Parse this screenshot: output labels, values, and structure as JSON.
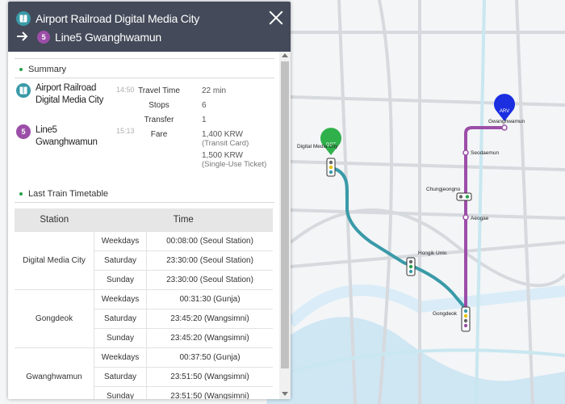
{
  "header": {
    "origin": "Airport Railroad Digital Media City",
    "origin_badge": "AREX",
    "destination": "Line5 Gwanghwamun",
    "destination_badge": "5"
  },
  "summary": {
    "title": "Summary",
    "from_station": [
      "Airport Railroad",
      "Digital Media City"
    ],
    "from_time": "14:50",
    "to_station": [
      "Line5",
      "Gwanghwamun"
    ],
    "to_time": "15:13",
    "labels": {
      "travel_time": "Travel Time",
      "stops": "Stops",
      "transfer": "Transfer",
      "fare": "Fare"
    },
    "values": {
      "travel_time": "22 min",
      "stops": "6",
      "transfer": "1",
      "fare_transit": "1,400 KRW",
      "fare_transit_note": "(Transit Card)",
      "fare_single": "1,500 KRW",
      "fare_single_note": "(Single-Use Ticket)"
    }
  },
  "timetable": {
    "title": "Last Train Timetable",
    "columns": [
      "Station",
      "Time"
    ],
    "rows": [
      {
        "station": "Digital Media City",
        "entries": [
          {
            "day": "Weekdays",
            "time": "00:08:00 (Seoul Station)"
          },
          {
            "day": "Saturday",
            "time": "23:30:00 (Seoul Station)"
          },
          {
            "day": "Sunday",
            "time": "23:30:00 (Seoul Station)"
          }
        ]
      },
      {
        "station": "Gongdeok",
        "entries": [
          {
            "day": "Weekdays",
            "time": "00:31:30 (Gunja)"
          },
          {
            "day": "Saturday",
            "time": "23:45:20 (Wangsimni)"
          },
          {
            "day": "Sunday",
            "time": "23:45:20 (Wangsimni)"
          }
        ]
      },
      {
        "station": "Gwanghwamun",
        "entries": [
          {
            "day": "Weekdays",
            "time": "00:37:50 (Gunja)"
          },
          {
            "day": "Saturday",
            "time": "23:51:50 (Wangsimni)"
          },
          {
            "day": "Sunday",
            "time": "23:51:50 (Wangsimni)"
          }
        ]
      }
    ]
  },
  "map": {
    "dpt_marker": "DPT",
    "arv_marker": "ARV",
    "labels": {
      "dmc": "Digital Media City",
      "gwanghwamun": "Gwanghwamun",
      "seodaemun": "Seodaemun",
      "chungjeongno": "Chungjeongno",
      "aeogae": "Aeogae",
      "hongik": "Hongik Univ.",
      "gongdeok": "Gongdeok"
    }
  },
  "colors": {
    "header_bg": "#444a59",
    "arex": "#3a9aa8",
    "line5": "#9b4ea7",
    "dpt_marker": "#2fb04a",
    "arv_marker": "#1b2ee0"
  }
}
